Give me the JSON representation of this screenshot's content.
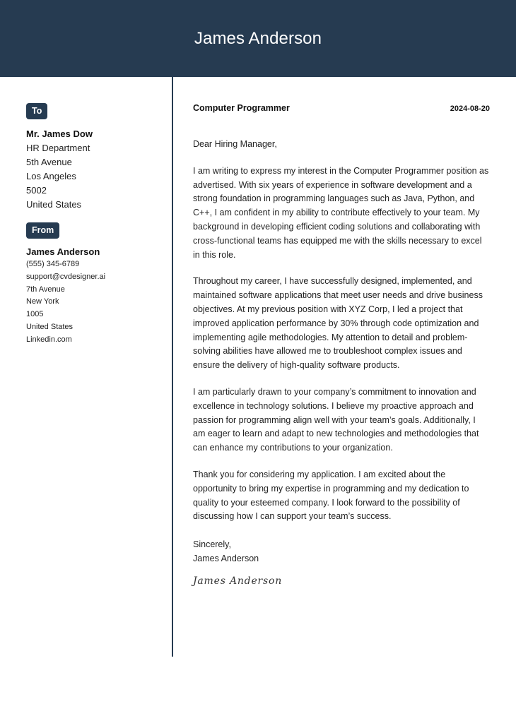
{
  "header": {
    "name": "James Anderson",
    "background_color": "#263b51"
  },
  "recipient": {
    "badge": "To",
    "name": "Mr. James Dow",
    "lines": [
      "HR Department",
      "5th Avenue",
      "Los Angeles",
      "5002",
      "United States"
    ]
  },
  "sender": {
    "badge": "From",
    "name": "James Anderson",
    "lines": [
      "(555) 345-6789",
      "support@cvdesigner.ai",
      "7th Avenue",
      "New York",
      "1005",
      "United States",
      "Linkedin.com"
    ]
  },
  "letter": {
    "position": "Computer Programmer",
    "date": "2024-08-20",
    "salutation": "Dear Hiring Manager,",
    "paragraphs": [
      "I am writing to express my interest in the Computer Programmer position as advertised. With six years of experience in software development and a strong foundation in programming languages such as Java, Python, and C++, I am confident in my ability to contribute effectively to your team. My background in developing efficient coding solutions and collaborating with cross-functional teams has equipped me with the skills necessary to excel in this role.",
      "Throughout my career, I have successfully designed, implemented, and maintained software applications that meet user needs and drive business objectives. At my previous position with XYZ Corp, I led a project that improved application performance by 30% through code optimization and implementing agile methodologies. My attention to detail and problem-solving abilities have allowed me to troubleshoot complex issues and ensure the delivery of high-quality software products.",
      "I am particularly drawn to your company’s commitment to innovation and excellence in technology solutions. I believe my proactive approach and passion for programming align well with your team’s goals. Additionally, I am eager to learn and adapt to new technologies and methodologies that can enhance my contributions to your organization.",
      "Thank you for considering my application. I am excited about the opportunity to bring my expertise in programming and my dedication to quality to your esteemed company. I look forward to the possibility of discussing how I can support your team’s success."
    ],
    "closing": "Sincerely,",
    "closing_name": "James Anderson",
    "signature": "James Anderson"
  }
}
